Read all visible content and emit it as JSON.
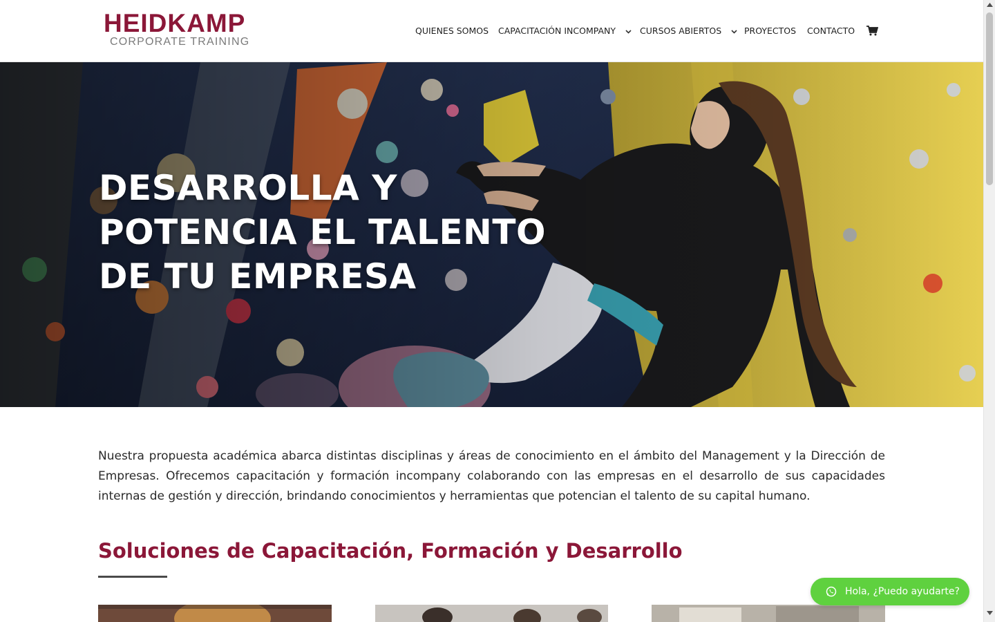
{
  "brand": {
    "name": "HEIDKAMP",
    "tagline": "CORPORATE TRAINING",
    "color": "#8b1738"
  },
  "nav": {
    "items": [
      {
        "label": "QUIENES SOMOS",
        "has_dropdown": false
      },
      {
        "label": "CAPACITACIÓN INCOMPANY",
        "has_dropdown": true
      },
      {
        "label": "CURSOS ABIERTOS",
        "has_dropdown": true
      },
      {
        "label": "PROYECTOS",
        "has_dropdown": false
      },
      {
        "label": "CONTACTO",
        "has_dropdown": false
      }
    ],
    "cart_icon": "shopping-cart-icon"
  },
  "hero": {
    "title_lines": [
      "DESARROLLA Y",
      "POTENCIA EL TALENTO",
      "DE TU EMPRESA"
    ]
  },
  "intro": {
    "text": "Nuestra propuesta académica abarca distintas disciplinas y áreas de conocimiento en el ámbito del Management y la Dirección de Empresas. Ofrecemos capacitación y formación incompany colaborando con las empresas en el desarrollo de sus capacidades internas de gestión y dirección, brindando conocimientos y herramientas que potencian el talento de su capital humano."
  },
  "solutions": {
    "title": "Soluciones de Capacitación, Formación y Desarrollo"
  },
  "whatsapp": {
    "label": "Hola, ¿Puedo ayudarte?",
    "icon": "whatsapp-icon",
    "color": "#5fd13f"
  },
  "colors": {
    "accent": "#8b1738",
    "whatsapp": "#5fd13f"
  }
}
